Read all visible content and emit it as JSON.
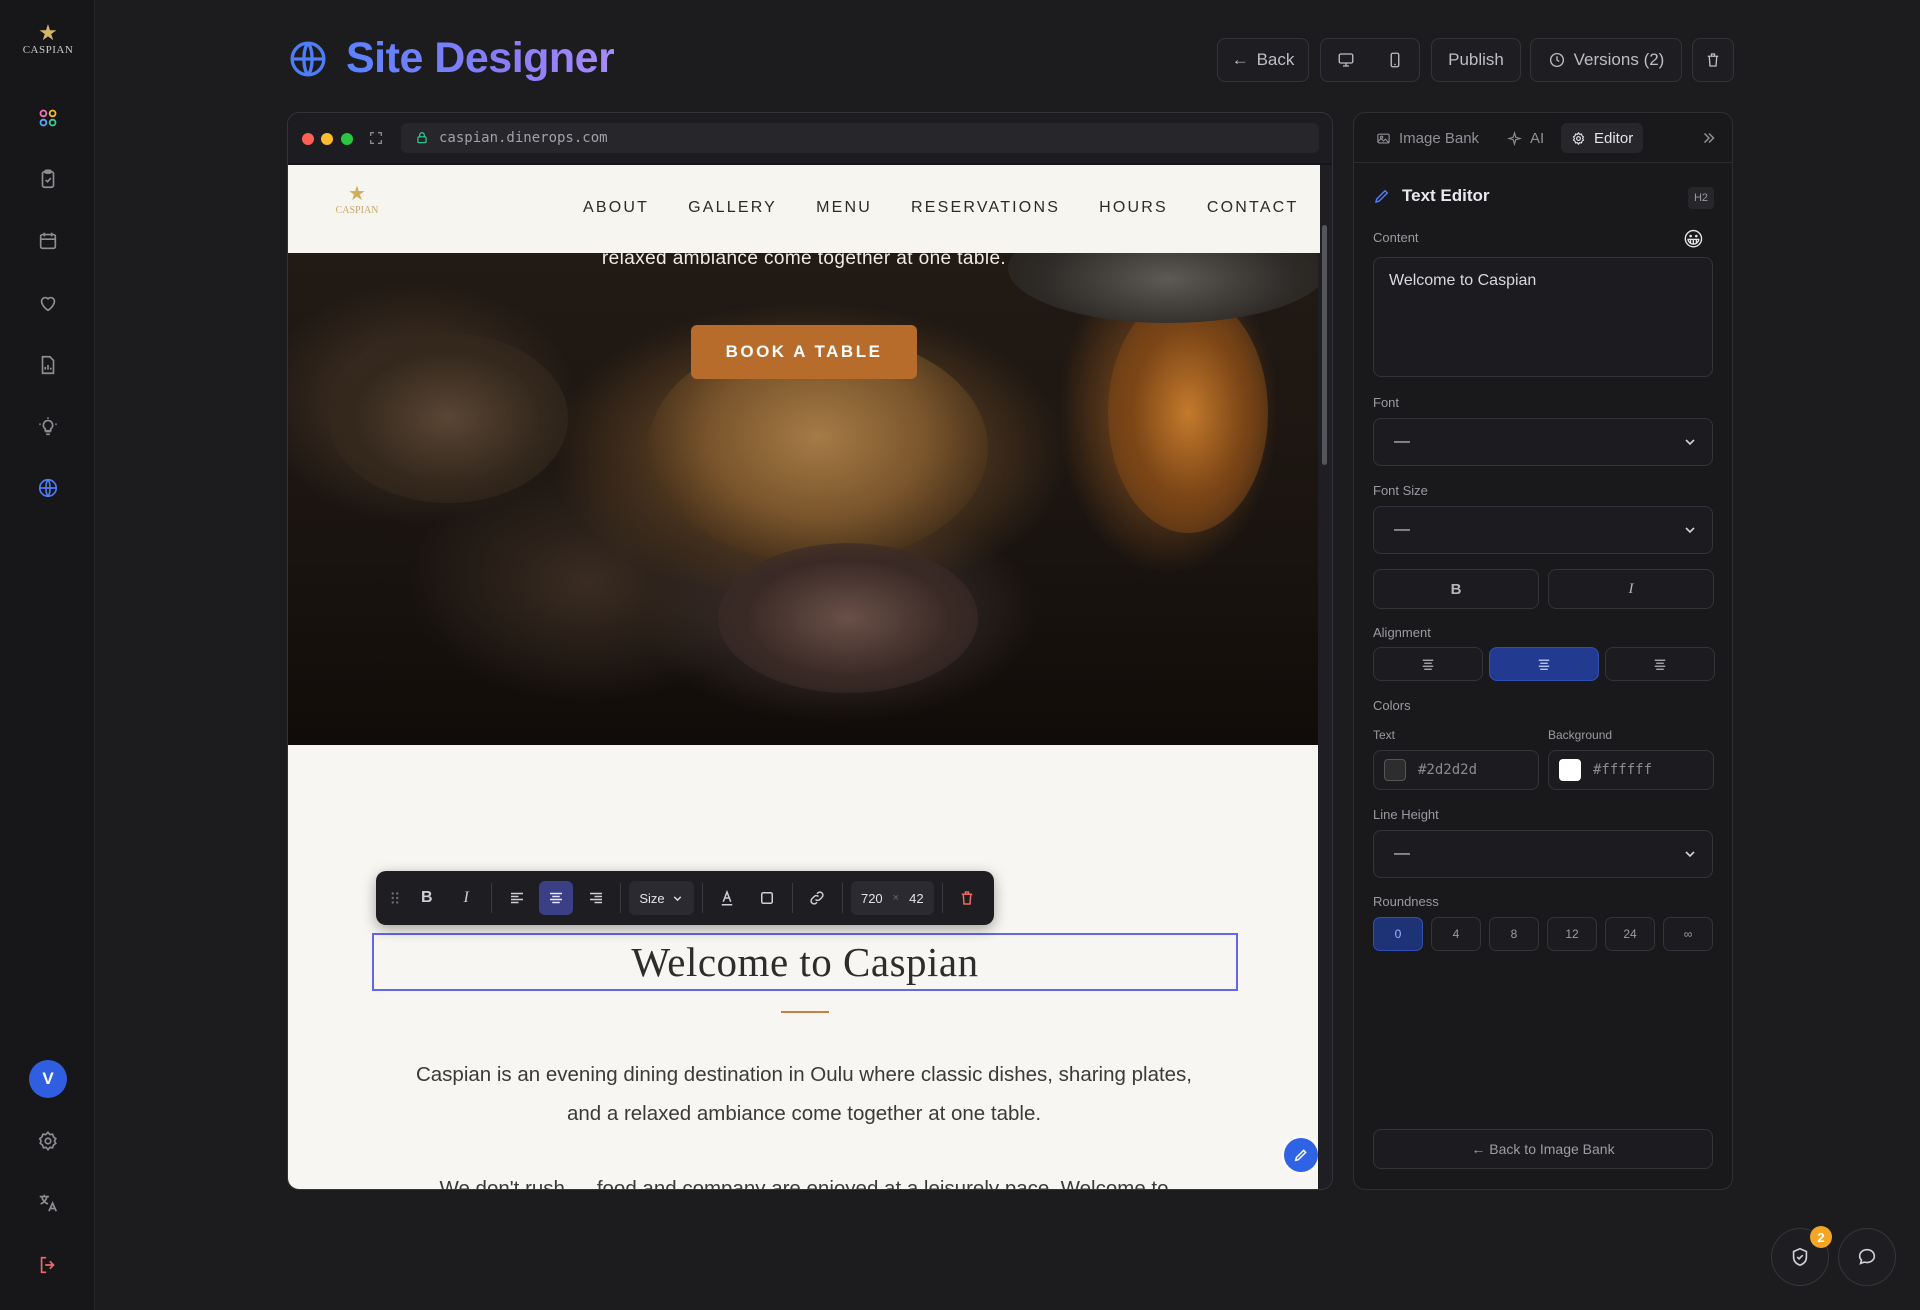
{
  "sidebar": {
    "logo_text": "CASPIAN",
    "avatar_initial": "V",
    "icons": [
      "apps-icon",
      "clipboard-icon",
      "calendar-icon",
      "heart-icon",
      "report-icon",
      "lightbulb-icon",
      "globe-icon",
      "settings-icon",
      "translate-icon",
      "logout-icon"
    ]
  },
  "header": {
    "title": "Site Designer",
    "back_label": "Back",
    "publish_label": "Publish",
    "versions_label": "Versions (2)"
  },
  "browser": {
    "url": "caspian.dinerops.com"
  },
  "site": {
    "logo_text": "CASPIAN",
    "nav": [
      "ABOUT",
      "GALLERY",
      "MENU",
      "RESERVATIONS",
      "HOURS",
      "CONTACT"
    ],
    "hero_text": "relaxed ambiance come together at one table.",
    "book_label": "BOOK A TABLE",
    "heading": "Welcome to Caspian",
    "para1_line1": "Caspian is an evening dining destination in Oulu where classic dishes, sharing plates,",
    "para1_line2": "and a relaxed ambiance come together at one table.",
    "para2": "We don't rush — food and company are enjoyed at a leisurely pace. Welcome to"
  },
  "toolbar": {
    "size_label": "Size",
    "width": "720",
    "height": "42",
    "times": "×"
  },
  "panel": {
    "tabs": [
      "Image Bank",
      "AI",
      "Editor"
    ],
    "section_title": "Text Editor",
    "tag": "H2",
    "content_label": "Content",
    "content_value": "Welcome to Caspian",
    "font_label": "Font",
    "font_value": "—",
    "font_size_label": "Font Size",
    "font_size_value": "—",
    "bold_label": "B",
    "italic_label": "I",
    "alignment_label": "Alignment",
    "colors_label": "Colors",
    "text_color_label": "Text",
    "text_color": "#2d2d2d",
    "background_label": "Background",
    "background_color": "#ffffff",
    "line_height_label": "Line Height",
    "line_height_value": "—",
    "roundness_label": "Roundness",
    "roundness_options": [
      "0",
      "4",
      "8",
      "12",
      "24",
      "∞"
    ],
    "back_button": "← Back to Image Bank"
  },
  "notifications": {
    "count": "2"
  },
  "colors": {
    "accent": "#4f7cf7",
    "button": "#b76c2c",
    "selection": "#6366f1"
  }
}
